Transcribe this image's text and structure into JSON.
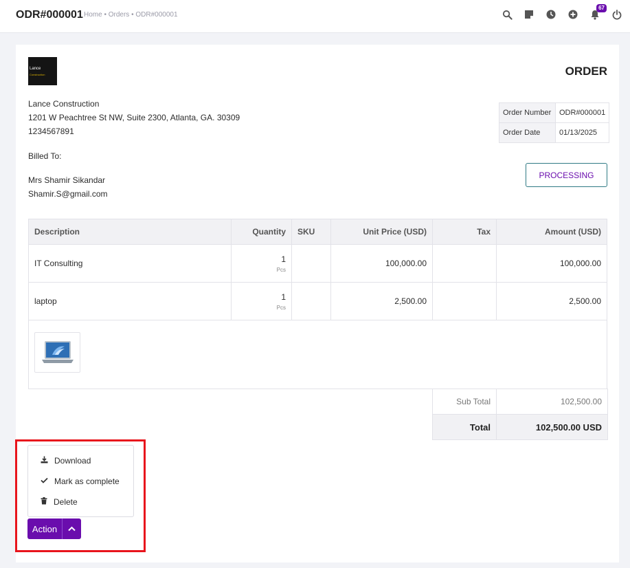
{
  "header": {
    "title": "ODR#000001",
    "breadcrumb": "Home • Orders • ODR#000001",
    "notification_count": "67",
    "icons": [
      "search-icon",
      "note-icon",
      "clock-icon",
      "plus-circle-icon",
      "bell-icon",
      "power-icon"
    ]
  },
  "logo": {
    "line1": "Lance",
    "line2": "Construction"
  },
  "doc_title": "ORDER",
  "company": {
    "name": "Lance Construction",
    "address": "1201 W Peachtree St NW, Suite 2300, Atlanta, GA. 30309",
    "phone": "1234567891"
  },
  "billed_to_label": "Billed To:",
  "customer": {
    "name": "Mrs Shamir Sikandar",
    "email": "Shamir.S@gmail.com"
  },
  "meta": {
    "order_number_label": "Order Number",
    "order_number": "ODR#000001",
    "order_date_label": "Order Date",
    "order_date": "01/13/2025"
  },
  "status": "PROCESSING",
  "columns": [
    "Description",
    "Quantity",
    "SKU",
    "Unit Price (USD)",
    "Tax",
    "Amount (USD)"
  ],
  "rows": [
    {
      "description": "IT Consulting",
      "quantity": "1",
      "unit": "Pcs",
      "sku": "",
      "unit_price": "100,000.00",
      "tax": "",
      "amount": "100,000.00"
    },
    {
      "description": "laptop",
      "quantity": "1",
      "unit": "Pcs",
      "sku": "",
      "unit_price": "2,500.00",
      "tax": "",
      "amount": "2,500.00"
    }
  ],
  "totals": {
    "subtotal_label": "Sub Total",
    "subtotal": "102,500.00",
    "total_label": "Total",
    "total": "102,500.00 USD"
  },
  "action_menu": {
    "items": [
      {
        "label": "Download",
        "icon": "download-icon"
      },
      {
        "label": "Mark as complete",
        "icon": "check-icon"
      },
      {
        "label": "Delete",
        "icon": "trash-icon"
      }
    ],
    "button_label": "Action"
  },
  "colors": {
    "accent": "#6a0dad",
    "highlight": "#e8141c",
    "status_border": "#2f7a84"
  }
}
